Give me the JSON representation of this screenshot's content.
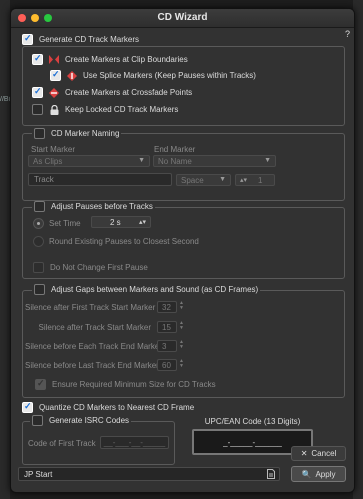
{
  "background": {
    "path_fragment": "//Bill"
  },
  "window": {
    "title": "CD Wizard",
    "help_label": "?"
  },
  "markers": {
    "generate_label": "Generate CD Track Markers",
    "clip_boundaries_label": "Create Markers at Clip Boundaries",
    "splice_label": "Use Splice Markers (Keep Pauses within Tracks)",
    "crossfade_label": "Create Markers at Crossfade Points",
    "keep_locked_label": "Keep Locked CD Track Markers"
  },
  "naming": {
    "group_label": "CD Marker Naming",
    "start_marker_label": "Start Marker",
    "start_marker_value": "As Clips",
    "end_marker_label": "End Marker",
    "end_marker_value": "No Name",
    "name_value": "Track",
    "separator_value": "Space",
    "number_value": "1"
  },
  "pauses": {
    "group_label": "Adjust Pauses before Tracks",
    "set_time_label": "Set Time",
    "set_time_value": "2 s",
    "round_label": "Round Existing Pauses to Closest Second",
    "no_change_first_label": "Do Not Change First Pause"
  },
  "gaps": {
    "group_label": "Adjust Gaps between Markers and Sound (as CD Frames)",
    "rows": [
      {
        "label": "Silence after First Track Start Marker",
        "value": "32"
      },
      {
        "label": "Silence after Track Start Marker",
        "value": "15"
      },
      {
        "label": "Silence before Each Track End Marker",
        "value": "3"
      },
      {
        "label": "Silence before Last Track End Marker",
        "value": "60"
      }
    ],
    "ensure_label": "Ensure Required Minimum Size for CD Tracks"
  },
  "quantize": {
    "label": "Quantize CD Markers to Nearest CD Frame"
  },
  "isrc": {
    "group_label": "Generate ISRC Codes",
    "code_label": "Code of First Track",
    "code_placeholder": "__-___-__-_____"
  },
  "upc": {
    "label": "UPC/EAN Code (13 Digits)",
    "value": "_-_____-______"
  },
  "footer": {
    "preset_value": "JP Start",
    "cancel_label": "Cancel",
    "apply_label": "Apply"
  },
  "colors": {
    "accent": "#1b6fd6",
    "marker_red": "#d94040",
    "dialog_bg": "#323232"
  }
}
